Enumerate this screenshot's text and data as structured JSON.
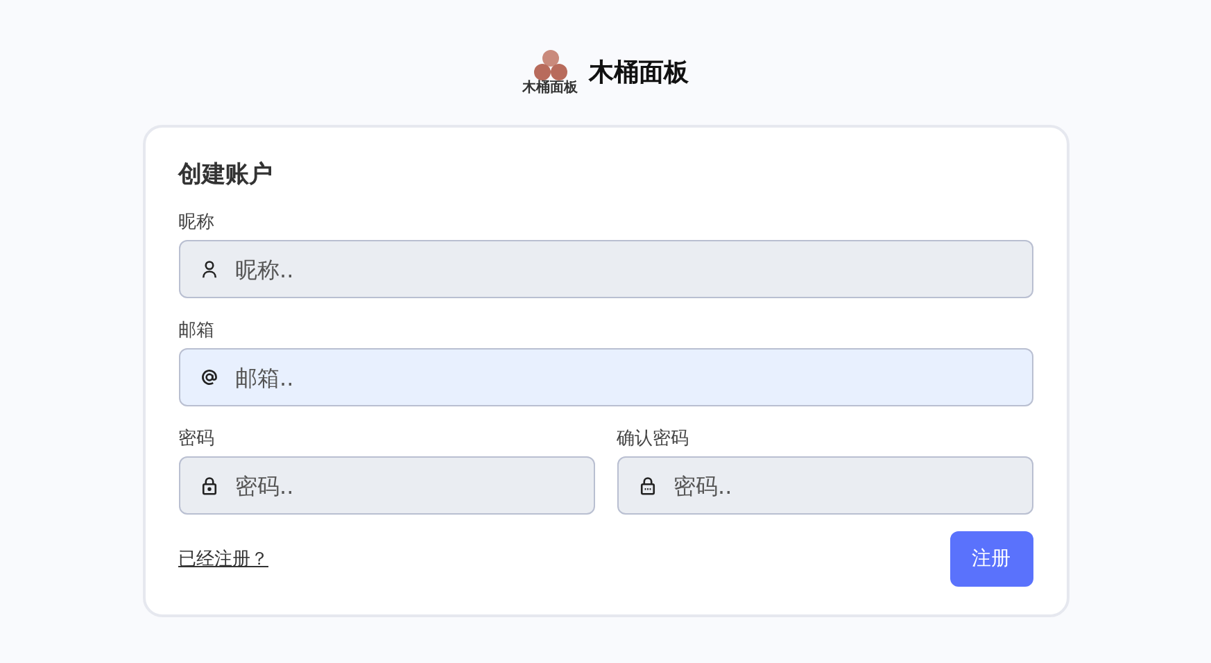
{
  "brand": {
    "logo_text": "木桶面板",
    "name": "木桶面板"
  },
  "form": {
    "title": "创建账户",
    "rows": [
      [
        {
          "label": "昵称",
          "placeholder": "昵称..",
          "kind": "user",
          "autofilled": false
        }
      ],
      [
        {
          "label": "邮箱",
          "placeholder": "邮箱..",
          "kind": "at",
          "autofilled": true
        }
      ],
      [
        {
          "label": "密码",
          "placeholder": "密码..",
          "kind": "lock",
          "autofilled": false
        },
        {
          "label": "确认密码",
          "placeholder": "密码..",
          "kind": "lock-dots",
          "autofilled": false
        }
      ]
    ],
    "login_link": "已经注册？",
    "submit": "注册"
  }
}
